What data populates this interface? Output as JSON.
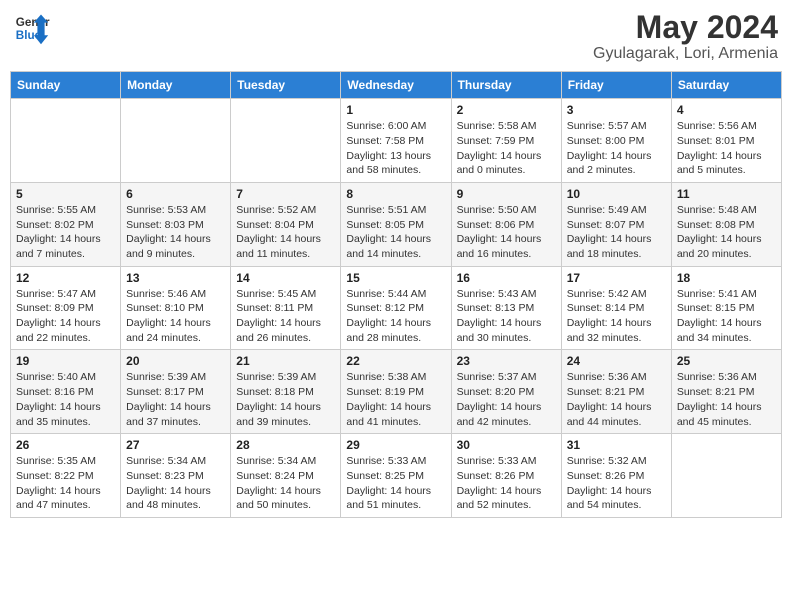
{
  "logo": {
    "general": "General",
    "blue": "Blue"
  },
  "header": {
    "month": "May 2024",
    "location": "Gyulagarak, Lori, Armenia"
  },
  "weekdays": [
    "Sunday",
    "Monday",
    "Tuesday",
    "Wednesday",
    "Thursday",
    "Friday",
    "Saturday"
  ],
  "weeks": [
    [
      {
        "day": "",
        "info": ""
      },
      {
        "day": "",
        "info": ""
      },
      {
        "day": "",
        "info": ""
      },
      {
        "day": "1",
        "info": "Sunrise: 6:00 AM\nSunset: 7:58 PM\nDaylight: 13 hours\nand 58 minutes."
      },
      {
        "day": "2",
        "info": "Sunrise: 5:58 AM\nSunset: 7:59 PM\nDaylight: 14 hours\nand 0 minutes."
      },
      {
        "day": "3",
        "info": "Sunrise: 5:57 AM\nSunset: 8:00 PM\nDaylight: 14 hours\nand 2 minutes."
      },
      {
        "day": "4",
        "info": "Sunrise: 5:56 AM\nSunset: 8:01 PM\nDaylight: 14 hours\nand 5 minutes."
      }
    ],
    [
      {
        "day": "5",
        "info": "Sunrise: 5:55 AM\nSunset: 8:02 PM\nDaylight: 14 hours\nand 7 minutes."
      },
      {
        "day": "6",
        "info": "Sunrise: 5:53 AM\nSunset: 8:03 PM\nDaylight: 14 hours\nand 9 minutes."
      },
      {
        "day": "7",
        "info": "Sunrise: 5:52 AM\nSunset: 8:04 PM\nDaylight: 14 hours\nand 11 minutes."
      },
      {
        "day": "8",
        "info": "Sunrise: 5:51 AM\nSunset: 8:05 PM\nDaylight: 14 hours\nand 14 minutes."
      },
      {
        "day": "9",
        "info": "Sunrise: 5:50 AM\nSunset: 8:06 PM\nDaylight: 14 hours\nand 16 minutes."
      },
      {
        "day": "10",
        "info": "Sunrise: 5:49 AM\nSunset: 8:07 PM\nDaylight: 14 hours\nand 18 minutes."
      },
      {
        "day": "11",
        "info": "Sunrise: 5:48 AM\nSunset: 8:08 PM\nDaylight: 14 hours\nand 20 minutes."
      }
    ],
    [
      {
        "day": "12",
        "info": "Sunrise: 5:47 AM\nSunset: 8:09 PM\nDaylight: 14 hours\nand 22 minutes."
      },
      {
        "day": "13",
        "info": "Sunrise: 5:46 AM\nSunset: 8:10 PM\nDaylight: 14 hours\nand 24 minutes."
      },
      {
        "day": "14",
        "info": "Sunrise: 5:45 AM\nSunset: 8:11 PM\nDaylight: 14 hours\nand 26 minutes."
      },
      {
        "day": "15",
        "info": "Sunrise: 5:44 AM\nSunset: 8:12 PM\nDaylight: 14 hours\nand 28 minutes."
      },
      {
        "day": "16",
        "info": "Sunrise: 5:43 AM\nSunset: 8:13 PM\nDaylight: 14 hours\nand 30 minutes."
      },
      {
        "day": "17",
        "info": "Sunrise: 5:42 AM\nSunset: 8:14 PM\nDaylight: 14 hours\nand 32 minutes."
      },
      {
        "day": "18",
        "info": "Sunrise: 5:41 AM\nSunset: 8:15 PM\nDaylight: 14 hours\nand 34 minutes."
      }
    ],
    [
      {
        "day": "19",
        "info": "Sunrise: 5:40 AM\nSunset: 8:16 PM\nDaylight: 14 hours\nand 35 minutes."
      },
      {
        "day": "20",
        "info": "Sunrise: 5:39 AM\nSunset: 8:17 PM\nDaylight: 14 hours\nand 37 minutes."
      },
      {
        "day": "21",
        "info": "Sunrise: 5:39 AM\nSunset: 8:18 PM\nDaylight: 14 hours\nand 39 minutes."
      },
      {
        "day": "22",
        "info": "Sunrise: 5:38 AM\nSunset: 8:19 PM\nDaylight: 14 hours\nand 41 minutes."
      },
      {
        "day": "23",
        "info": "Sunrise: 5:37 AM\nSunset: 8:20 PM\nDaylight: 14 hours\nand 42 minutes."
      },
      {
        "day": "24",
        "info": "Sunrise: 5:36 AM\nSunset: 8:21 PM\nDaylight: 14 hours\nand 44 minutes."
      },
      {
        "day": "25",
        "info": "Sunrise: 5:36 AM\nSunset: 8:21 PM\nDaylight: 14 hours\nand 45 minutes."
      }
    ],
    [
      {
        "day": "26",
        "info": "Sunrise: 5:35 AM\nSunset: 8:22 PM\nDaylight: 14 hours\nand 47 minutes."
      },
      {
        "day": "27",
        "info": "Sunrise: 5:34 AM\nSunset: 8:23 PM\nDaylight: 14 hours\nand 48 minutes."
      },
      {
        "day": "28",
        "info": "Sunrise: 5:34 AM\nSunset: 8:24 PM\nDaylight: 14 hours\nand 50 minutes."
      },
      {
        "day": "29",
        "info": "Sunrise: 5:33 AM\nSunset: 8:25 PM\nDaylight: 14 hours\nand 51 minutes."
      },
      {
        "day": "30",
        "info": "Sunrise: 5:33 AM\nSunset: 8:26 PM\nDaylight: 14 hours\nand 52 minutes."
      },
      {
        "day": "31",
        "info": "Sunrise: 5:32 AM\nSunset: 8:26 PM\nDaylight: 14 hours\nand 54 minutes."
      },
      {
        "day": "",
        "info": ""
      }
    ]
  ]
}
